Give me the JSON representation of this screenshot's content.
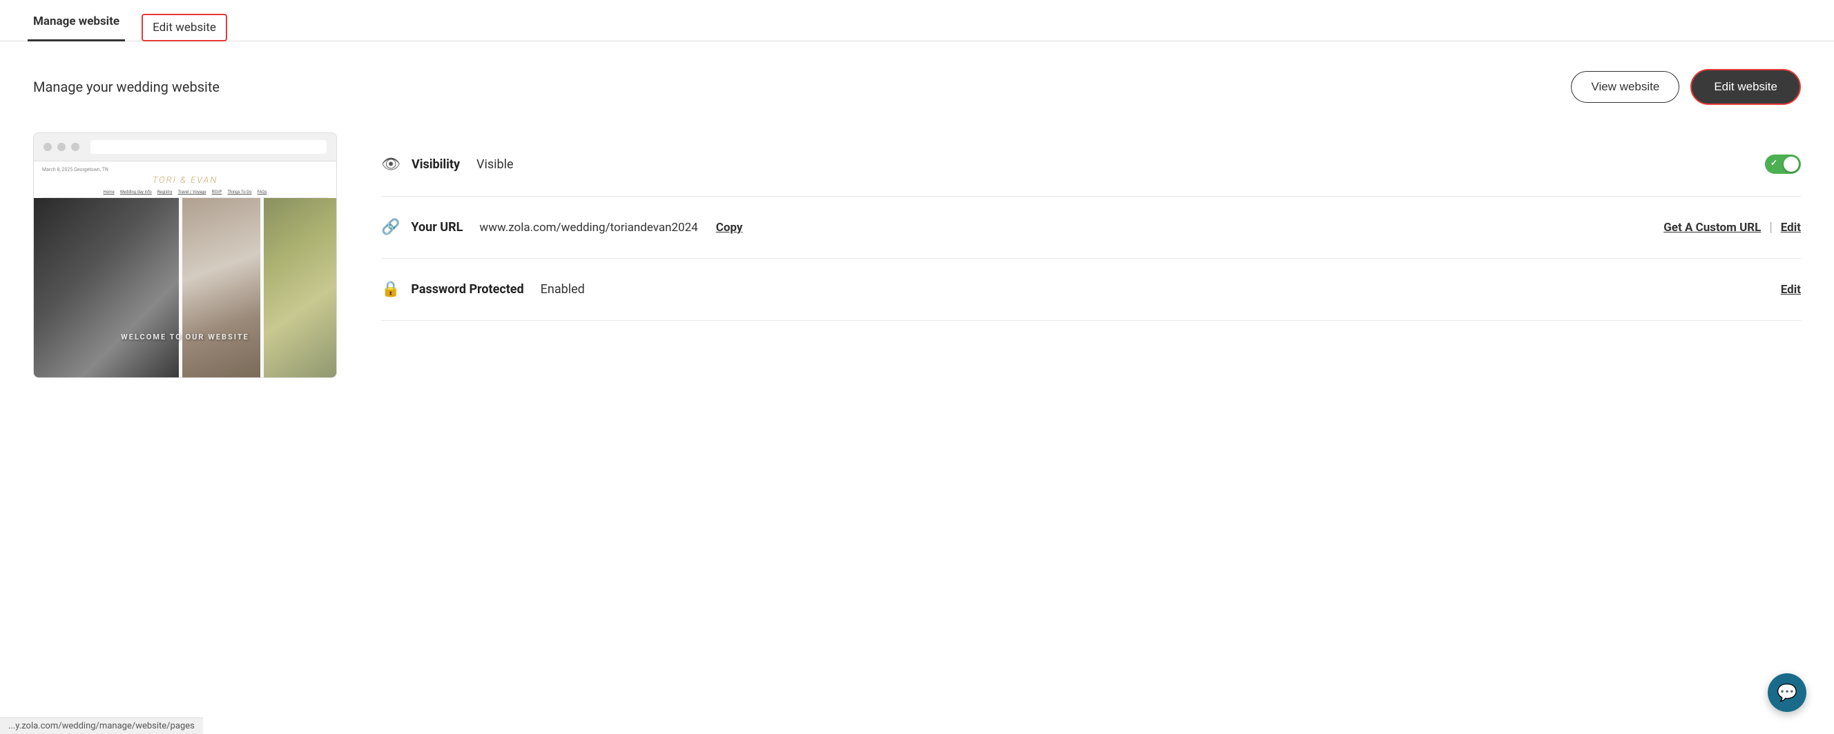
{
  "tabs": {
    "manage": "Manage website",
    "edit": "Edit website"
  },
  "header": {
    "title": "Manage your wedding website",
    "view_btn": "View website",
    "edit_btn": "Edit website"
  },
  "preview": {
    "date_location": "March 8, 2025   Georgetown, TN",
    "couple_name": "TORI & EVAN",
    "nav_items": [
      "Home",
      "Wedding day info",
      "Registry",
      "Travel / Voyage",
      "RSVP",
      "Things To Do",
      "FAQs"
    ],
    "welcome_text": "WELCOME TO OUR WEBSITE"
  },
  "settings": {
    "visibility": {
      "label": "Visibility",
      "value": "Visible",
      "icon": "👁",
      "toggle_on": true
    },
    "url": {
      "label": "Your URL",
      "value": "www.zola.com/wedding/toriandevan2024",
      "copy_label": "Copy",
      "icon": "🔗",
      "custom_url_label": "Get A Custom URL",
      "edit_label": "Edit"
    },
    "password": {
      "label": "Password Protected",
      "value": "Enabled",
      "icon": "🔒",
      "edit_label": "Edit"
    }
  },
  "bottom_url": "...y.zola.com/wedding/manage/website/pages",
  "chat_icon": "💬"
}
